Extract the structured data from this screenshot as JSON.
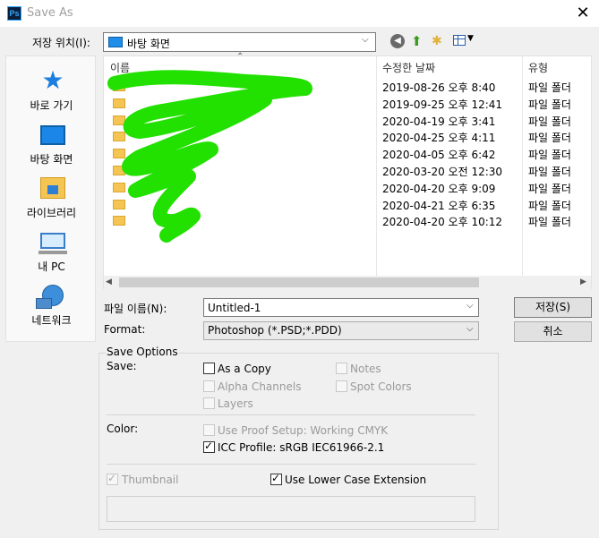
{
  "window": {
    "title": "Save As",
    "app_icon": "Ps",
    "close_glyph": "✕"
  },
  "location": {
    "label": "저장 위치(I):",
    "value": "바탕 화면"
  },
  "sidebar": {
    "items": [
      {
        "label": "바로 가기",
        "icon": "quick-access-star-icon"
      },
      {
        "label": "바탕 화면",
        "icon": "desktop-icon"
      },
      {
        "label": "라이브러리",
        "icon": "libraries-icon"
      },
      {
        "label": "내 PC",
        "icon": "computer-icon"
      },
      {
        "label": "네트워크",
        "icon": "network-icon"
      }
    ]
  },
  "filelist": {
    "columns": {
      "name": "이름",
      "date": "수정한 날짜",
      "type": "유형"
    },
    "rows": [
      {
        "date": "2019-08-26 오후 8:40",
        "type": "파일 폴더"
      },
      {
        "date": "2019-09-25 오후 12:41",
        "type": "파일 폴더"
      },
      {
        "date": "2020-04-19 오후 3:41",
        "type": "파일 폴더"
      },
      {
        "date": "2020-04-25 오후 4:11",
        "type": "파일 폴더"
      },
      {
        "date": "2020-04-05 오후 6:42",
        "type": "파일 폴더"
      },
      {
        "date": "2020-03-20 오전 12:30",
        "type": "파일 폴더"
      },
      {
        "date": "2020-04-20 오후 9:09",
        "type": "파일 폴더"
      },
      {
        "date": "2020-04-21 오후 6:35",
        "type": "파일 폴더"
      },
      {
        "date": "2020-04-20 오후 10:12",
        "type": "파일 폴더"
      }
    ],
    "redaction_color": "#22e000"
  },
  "filename": {
    "label": "파일 이름(N):",
    "value": "Untitled-1"
  },
  "format": {
    "label": "Format:",
    "value": "Photoshop (*.PSD;*.PDD)"
  },
  "buttons": {
    "save": "저장(S)",
    "cancel": "취소"
  },
  "options": {
    "title": "Save Options",
    "save_label": "Save:",
    "as_copy": "As a Copy",
    "notes": "Notes",
    "alpha_channels": "Alpha Channels",
    "spot_colors": "Spot Colors",
    "layers": "Layers",
    "color_label": "Color:",
    "use_proof": "Use Proof Setup:  Working CMYK",
    "icc_profile": "ICC Profile:  sRGB IEC61966-2.1",
    "thumbnail": "Thumbnail",
    "lower_case": "Use Lower Case Extension"
  }
}
